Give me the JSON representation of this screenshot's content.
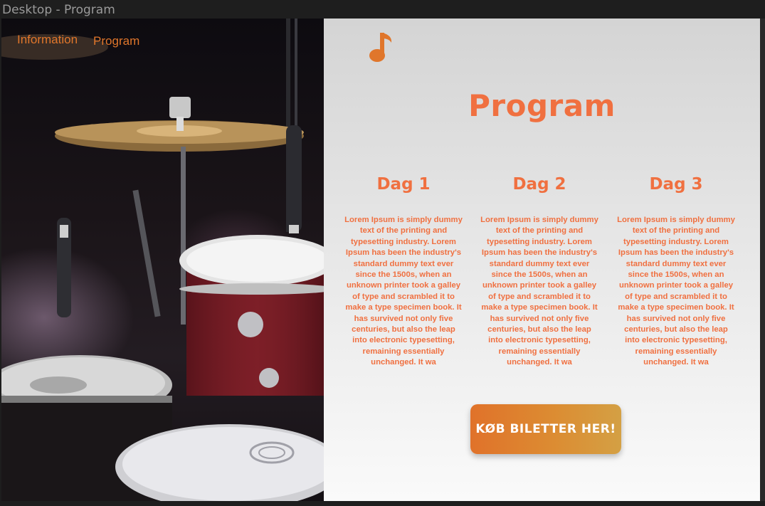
{
  "window": {
    "frame_label": "Desktop - Program"
  },
  "nav": {
    "items": [
      {
        "label": "Information"
      },
      {
        "label": "Program"
      }
    ]
  },
  "icons": {
    "logo": "music-note-icon"
  },
  "main": {
    "title": "Program",
    "days": [
      {
        "heading": "Dag 1",
        "body": "Lorem Ipsum is simply dummy text of the printing and typesetting industry. Lorem Ipsum has been the industry's standard dummy text ever since the 1500s, when an unknown printer took a galley of type and scrambled it to make a type specimen book. It has survived not only five centuries, but also the leap into electronic typesetting, remaining essentially unchanged. It wa"
      },
      {
        "heading": "Dag 2",
        "body": "Lorem Ipsum is simply dummy text of the printing and typesetting industry. Lorem Ipsum has been the industry's standard dummy text ever since the 1500s, when an unknown printer took a galley of type and scrambled it to make a type specimen book. It has survived not only five centuries, but also the leap into electronic typesetting, remaining essentially unchanged. It wa"
      },
      {
        "heading": "Dag 3",
        "body": "Lorem Ipsum is simply dummy text of the printing and typesetting industry. Lorem Ipsum has been the industry's standard dummy text ever since the 1500s, when an unknown printer took a galley of type and scrambled it to make a type specimen book. It has survived not only five centuries, but also the leap into electronic typesetting, remaining essentially unchanged. It wa"
      }
    ],
    "cta_label": "KØB BILETTER HER!"
  },
  "colors": {
    "accent": "#f07040",
    "nav": "#e0762b",
    "button_start": "#e0722a",
    "button_end": "#d4a044"
  }
}
